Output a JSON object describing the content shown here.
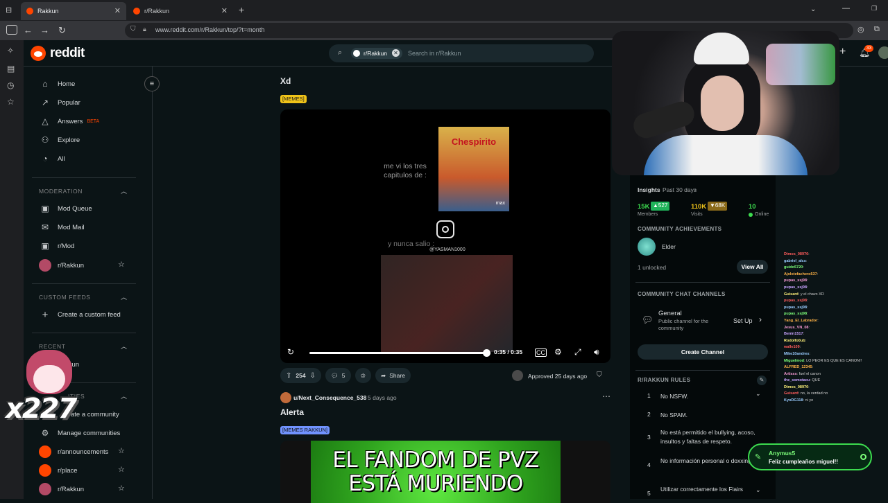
{
  "browser": {
    "tabs": [
      {
        "label": "Rakkun",
        "active": true
      },
      {
        "label": "r/Rakkun",
        "active": false
      }
    ],
    "new_tab": "+",
    "url": "www.reddit.com/r/Rakkun/top/?t=month"
  },
  "header": {
    "logo": "reddit",
    "search_chip": "r/Rakkun",
    "search_placeholder": "Search in r/Rakkun",
    "notification_count": "33"
  },
  "sidebar": {
    "main": [
      {
        "label": "Home",
        "icon": "home-icon"
      },
      {
        "label": "Popular",
        "icon": "popular-icon"
      },
      {
        "label": "Answers",
        "icon": "answers-icon",
        "badge": "BETA"
      },
      {
        "label": "Explore",
        "icon": "explore-icon"
      },
      {
        "label": "All",
        "icon": "all-icon"
      }
    ],
    "moderation_heading": "MODERATION",
    "moderation": [
      {
        "label": "Mod Queue"
      },
      {
        "label": "Mod Mail"
      },
      {
        "label": "r/Mod"
      },
      {
        "label": "r/Rakkun"
      }
    ],
    "custom_feeds_heading": "CUSTOM FEEDS",
    "create_feed": "Create a custom feed",
    "recent_heading": "RECENT",
    "recent_item": "kkun",
    "communities_heading": "ITIES",
    "create_community": "ate a community",
    "manage_communities": "Manage communities",
    "communities": [
      "r/announcements",
      "r/place",
      "r/Rakkun"
    ]
  },
  "feed": {
    "post1": {
      "title": "Xd",
      "flair": "[MEMES]",
      "video": {
        "text_top": "me vi los tres capitulos de :",
        "poster_title": "Chespirito",
        "poster_brand": "max",
        "text_bottom": "y nunca salio :",
        "handle": "@YASMAN1000",
        "time": "0:35 / 0:35"
      },
      "upvotes": "254",
      "comments": "5",
      "share": "Share",
      "approved": "Approved 25 days ago"
    },
    "post2": {
      "author": "u/Next_Consequence_538",
      "age": "5 days ago",
      "title": "Alerta",
      "flair": "[MEMES RAKKUN]",
      "banner_line1": "EL FANDOM DE PVZ",
      "banner_line2": "ESTÁ MURIENDO"
    }
  },
  "right_panel": {
    "insights_label": "Insights",
    "insights_range": "Past 30 days",
    "stats": [
      {
        "value": "15K",
        "delta": "527",
        "label": "Members"
      },
      {
        "value": "110K",
        "delta": "68K",
        "label": "Visits"
      },
      {
        "value": "10",
        "label": "Online"
      }
    ],
    "achievements_heading": "COMMUNITY ACHIEVEMENTS",
    "achievement": "Elder",
    "unlocked": "1 unlocked",
    "view_all": "View All",
    "chat_heading": "COMMUNITY CHAT CHANNELS",
    "channel_name": "General",
    "channel_desc": "Public channel for the community",
    "set_up": "Set Up",
    "create_channel": "Create Channel",
    "rules_heading": "R/RAKKUN RULES",
    "rules": [
      {
        "n": "1",
        "text": "No NSFW."
      },
      {
        "n": "2",
        "text": "No SPAM."
      },
      {
        "n": "3",
        "text": "No está permitido el bullying, acoso, insultos y faltas de respeto."
      },
      {
        "n": "4",
        "text": "No información personal o doxxing."
      },
      {
        "n": "5",
        "text": "Utilizar correctamente los Flairs"
      }
    ]
  },
  "stream_overlay": {
    "chat": [
      {
        "user": "Dimos_08970",
        "msg": ":"
      },
      {
        "user": "gabriel_alcs",
        "msg": ":"
      },
      {
        "user": "guido5720",
        "msg": ":"
      },
      {
        "user": "Ajolotefachero537",
        "msg": ":"
      },
      {
        "user": "pupas_ssj98",
        "msg": ":"
      },
      {
        "user": "pupas_ssj98",
        "msg": ":"
      },
      {
        "user": "Guisard",
        "msg": ": y el chavo XD"
      },
      {
        "user": "pupas_ssj98",
        "msg": ":"
      },
      {
        "user": "pupas_ssj98",
        "msg": ":"
      },
      {
        "user": "pupas_ssj98",
        "msg": ":"
      },
      {
        "user": "Yang_El_Labrador",
        "msg": ":"
      },
      {
        "user": "Jesus_VN_08",
        "msg": ":"
      },
      {
        "user": "Benin1517",
        "msg": ":"
      },
      {
        "user": "Rodolfo0ub",
        "msg": ":"
      },
      {
        "user": "walle109",
        "msg": ":"
      },
      {
        "user": "Mike10andres",
        "msg": ":"
      },
      {
        "user": "Miguelmod",
        "msg": ": LO PEOR ES QUE ES CANON!!"
      },
      {
        "user": "ALFRED_12345",
        "msg": ":"
      },
      {
        "user": "Artisss",
        "msg": ": fuel el canon"
      },
      {
        "user": "the_somotacu",
        "msg": ": QUE"
      },
      {
        "user": "Dimos_08970",
        "msg": ":"
      },
      {
        "user": "Guisard",
        "msg": ": no, la verdad no"
      },
      {
        "user": "KyoDG118",
        "msg": ": ni yo"
      }
    ],
    "alert_user": "Anymus5",
    "alert_msg": "Feliz cumpleaños miguel!!",
    "combo": "x227"
  },
  "colors": {
    "accent": "#ff4500",
    "flair_memes": "#f0c419",
    "flair_rakkun": "#7193ff",
    "green": "#3ddc4f"
  }
}
